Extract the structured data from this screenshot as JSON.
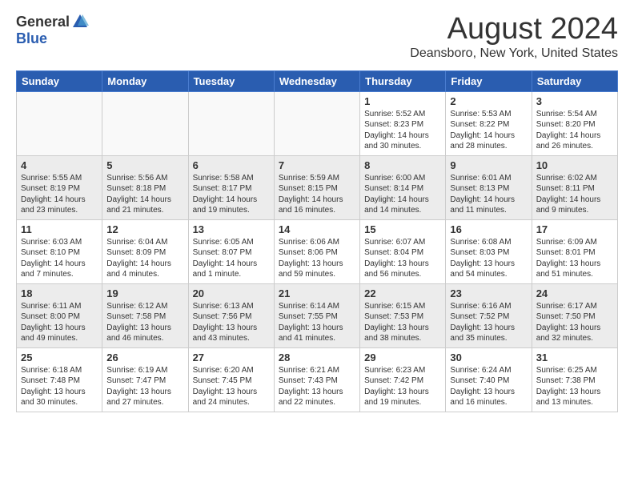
{
  "header": {
    "logo_general": "General",
    "logo_blue": "Blue",
    "month_title": "August 2024",
    "location": "Deansboro, New York, United States"
  },
  "weekdays": [
    "Sunday",
    "Monday",
    "Tuesday",
    "Wednesday",
    "Thursday",
    "Friday",
    "Saturday"
  ],
  "weeks": [
    [
      {
        "day": "",
        "info": ""
      },
      {
        "day": "",
        "info": ""
      },
      {
        "day": "",
        "info": ""
      },
      {
        "day": "",
        "info": ""
      },
      {
        "day": "1",
        "info": "Sunrise: 5:52 AM\nSunset: 8:23 PM\nDaylight: 14 hours\nand 30 minutes."
      },
      {
        "day": "2",
        "info": "Sunrise: 5:53 AM\nSunset: 8:22 PM\nDaylight: 14 hours\nand 28 minutes."
      },
      {
        "day": "3",
        "info": "Sunrise: 5:54 AM\nSunset: 8:20 PM\nDaylight: 14 hours\nand 26 minutes."
      }
    ],
    [
      {
        "day": "4",
        "info": "Sunrise: 5:55 AM\nSunset: 8:19 PM\nDaylight: 14 hours\nand 23 minutes."
      },
      {
        "day": "5",
        "info": "Sunrise: 5:56 AM\nSunset: 8:18 PM\nDaylight: 14 hours\nand 21 minutes."
      },
      {
        "day": "6",
        "info": "Sunrise: 5:58 AM\nSunset: 8:17 PM\nDaylight: 14 hours\nand 19 minutes."
      },
      {
        "day": "7",
        "info": "Sunrise: 5:59 AM\nSunset: 8:15 PM\nDaylight: 14 hours\nand 16 minutes."
      },
      {
        "day": "8",
        "info": "Sunrise: 6:00 AM\nSunset: 8:14 PM\nDaylight: 14 hours\nand 14 minutes."
      },
      {
        "day": "9",
        "info": "Sunrise: 6:01 AM\nSunset: 8:13 PM\nDaylight: 14 hours\nand 11 minutes."
      },
      {
        "day": "10",
        "info": "Sunrise: 6:02 AM\nSunset: 8:11 PM\nDaylight: 14 hours\nand 9 minutes."
      }
    ],
    [
      {
        "day": "11",
        "info": "Sunrise: 6:03 AM\nSunset: 8:10 PM\nDaylight: 14 hours\nand 7 minutes."
      },
      {
        "day": "12",
        "info": "Sunrise: 6:04 AM\nSunset: 8:09 PM\nDaylight: 14 hours\nand 4 minutes."
      },
      {
        "day": "13",
        "info": "Sunrise: 6:05 AM\nSunset: 8:07 PM\nDaylight: 14 hours\nand 1 minute."
      },
      {
        "day": "14",
        "info": "Sunrise: 6:06 AM\nSunset: 8:06 PM\nDaylight: 13 hours\nand 59 minutes."
      },
      {
        "day": "15",
        "info": "Sunrise: 6:07 AM\nSunset: 8:04 PM\nDaylight: 13 hours\nand 56 minutes."
      },
      {
        "day": "16",
        "info": "Sunrise: 6:08 AM\nSunset: 8:03 PM\nDaylight: 13 hours\nand 54 minutes."
      },
      {
        "day": "17",
        "info": "Sunrise: 6:09 AM\nSunset: 8:01 PM\nDaylight: 13 hours\nand 51 minutes."
      }
    ],
    [
      {
        "day": "18",
        "info": "Sunrise: 6:11 AM\nSunset: 8:00 PM\nDaylight: 13 hours\nand 49 minutes."
      },
      {
        "day": "19",
        "info": "Sunrise: 6:12 AM\nSunset: 7:58 PM\nDaylight: 13 hours\nand 46 minutes."
      },
      {
        "day": "20",
        "info": "Sunrise: 6:13 AM\nSunset: 7:56 PM\nDaylight: 13 hours\nand 43 minutes."
      },
      {
        "day": "21",
        "info": "Sunrise: 6:14 AM\nSunset: 7:55 PM\nDaylight: 13 hours\nand 41 minutes."
      },
      {
        "day": "22",
        "info": "Sunrise: 6:15 AM\nSunset: 7:53 PM\nDaylight: 13 hours\nand 38 minutes."
      },
      {
        "day": "23",
        "info": "Sunrise: 6:16 AM\nSunset: 7:52 PM\nDaylight: 13 hours\nand 35 minutes."
      },
      {
        "day": "24",
        "info": "Sunrise: 6:17 AM\nSunset: 7:50 PM\nDaylight: 13 hours\nand 32 minutes."
      }
    ],
    [
      {
        "day": "25",
        "info": "Sunrise: 6:18 AM\nSunset: 7:48 PM\nDaylight: 13 hours\nand 30 minutes."
      },
      {
        "day": "26",
        "info": "Sunrise: 6:19 AM\nSunset: 7:47 PM\nDaylight: 13 hours\nand 27 minutes."
      },
      {
        "day": "27",
        "info": "Sunrise: 6:20 AM\nSunset: 7:45 PM\nDaylight: 13 hours\nand 24 minutes."
      },
      {
        "day": "28",
        "info": "Sunrise: 6:21 AM\nSunset: 7:43 PM\nDaylight: 13 hours\nand 22 minutes."
      },
      {
        "day": "29",
        "info": "Sunrise: 6:23 AM\nSunset: 7:42 PM\nDaylight: 13 hours\nand 19 minutes."
      },
      {
        "day": "30",
        "info": "Sunrise: 6:24 AM\nSunset: 7:40 PM\nDaylight: 13 hours\nand 16 minutes."
      },
      {
        "day": "31",
        "info": "Sunrise: 6:25 AM\nSunset: 7:38 PM\nDaylight: 13 hours\nand 13 minutes."
      }
    ]
  ]
}
